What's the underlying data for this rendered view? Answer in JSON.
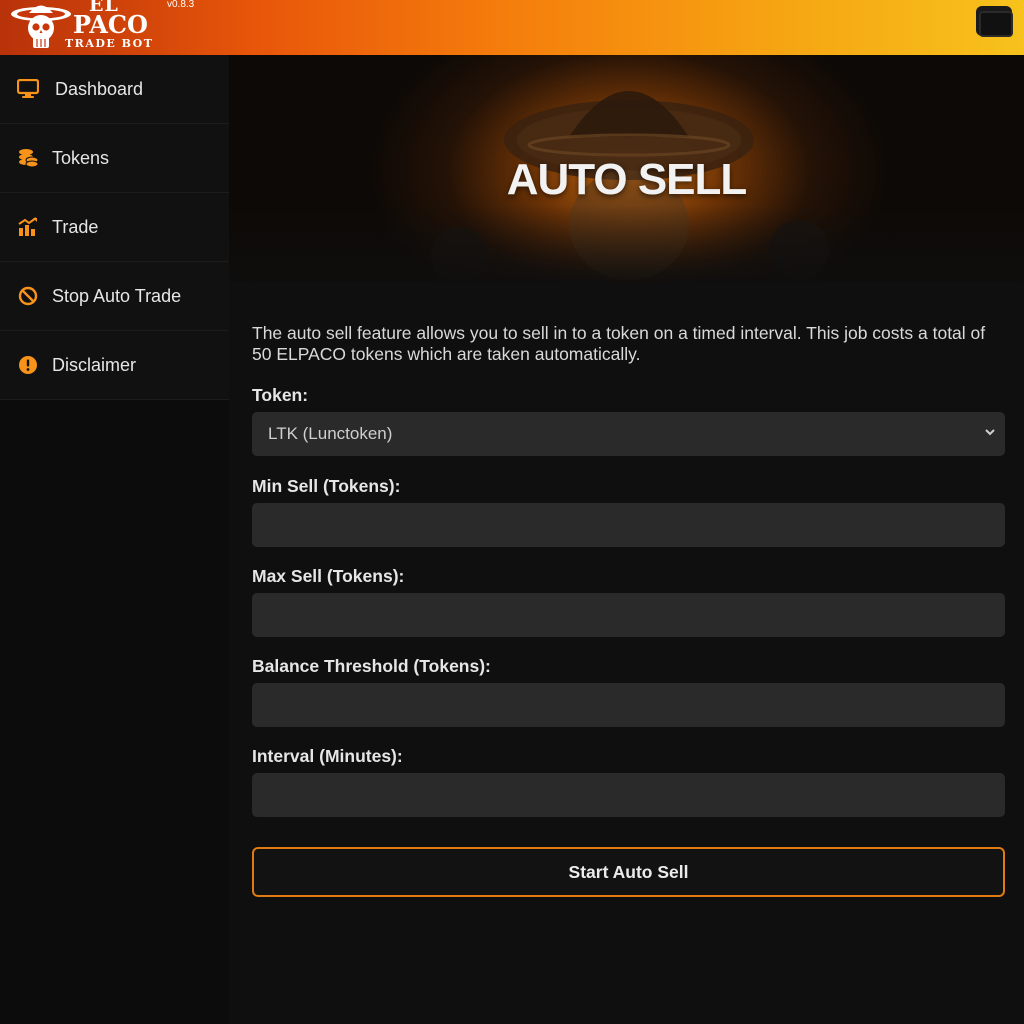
{
  "header": {
    "logo_el": "EL",
    "logo_paco": "PACO",
    "logo_tagline": "TRADE BOT",
    "version": "v0.8.3",
    "wallet_icon": "wallet-icon"
  },
  "sidebar": {
    "items": [
      {
        "label": "Dashboard",
        "icon": "monitor-icon"
      },
      {
        "label": "Tokens",
        "icon": "coins-icon"
      },
      {
        "label": "Trade",
        "icon": "trade-chart-icon"
      },
      {
        "label": "Stop Auto Trade",
        "icon": "ban-icon"
      },
      {
        "label": "Disclaimer",
        "icon": "exclamation-circle-icon"
      }
    ]
  },
  "main": {
    "hero_title": "AUTO SELL",
    "description": "The auto sell feature allows you to sell in to a token on a timed interval. This job costs a total of 50 ELPACO tokens which are taken automatically.",
    "token": {
      "label": "Token:",
      "selected": "LTK (Lunctoken)"
    },
    "min_sell": {
      "label": "Min Sell (Tokens):",
      "value": ""
    },
    "max_sell": {
      "label": "Max Sell (Tokens):",
      "value": ""
    },
    "balance_threshold": {
      "label": "Balance Threshold (Tokens):",
      "value": ""
    },
    "interval": {
      "label": "Interval (Minutes):",
      "value": ""
    },
    "submit_label": "Start Auto Sell"
  },
  "colors": {
    "accent": "#f7931a",
    "header_gradient_start": "#b8320a",
    "header_gradient_end": "#f7c21c",
    "button_border": "#e07a12",
    "input_bg": "#2a2a2a",
    "sidebar_bg": "#111111"
  }
}
